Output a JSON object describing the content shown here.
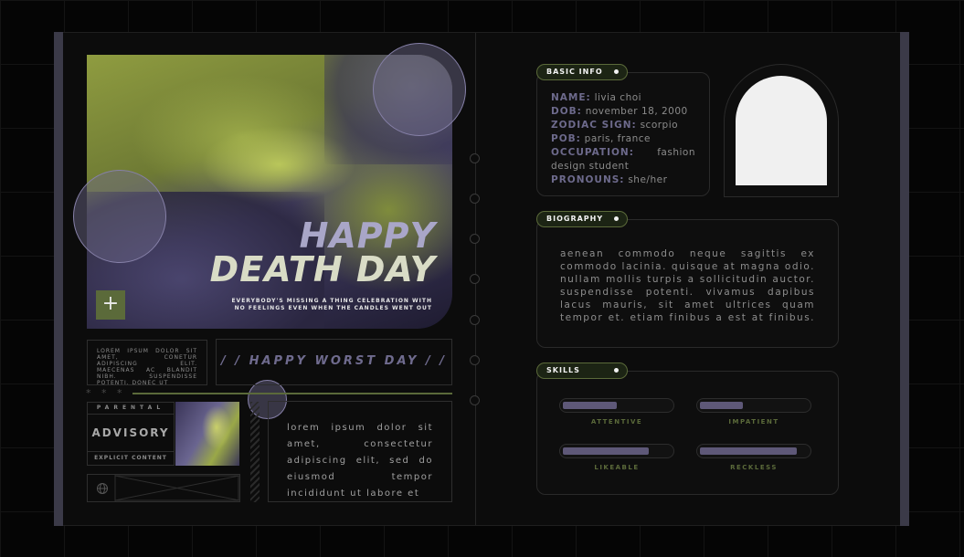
{
  "colors": {
    "accent_green": "#5b6a3a",
    "accent_purple": "#5e5878",
    "background": "#0c0c0c"
  },
  "hero": {
    "title_line1": "HAPPY",
    "title_line2": "DEATH DAY",
    "tagline": "EVERYBODY'S MISSING A THING CELEBRATION WITH NO FEELINGS EVEN WHEN THE CANDLES WENT OUT",
    "plus_icon": "plus-icon"
  },
  "left_blocks": {
    "small_lorem": "LOREM IPSUM DOLOR SIT AMET, CONETUR ADIPISCING ELIT. MAECENAS AC BLANDIT NIBH. SUSPENDISSE POTENTI. DONEC UT",
    "worst_day": "/ / HAPPY WORST DAY / /",
    "stars": "* * *",
    "parental": "PARENTAL",
    "advisory": "ADVISORY",
    "explicit": "EXPLICIT CONTENT",
    "lorem_medium": "lorem ipsum dolor sit amet, consectetur adipiscing elit, sed do eiusmod tempor incididunt ut labore et"
  },
  "basic_info": {
    "heading": "BASIC INFO",
    "rows": [
      {
        "label": "NAME:",
        "value": "livia choi"
      },
      {
        "label": "DOB:",
        "value": "november 18, 2000"
      },
      {
        "label": "ZODIAC SIGN:",
        "value": "scorpio"
      },
      {
        "label": "POB:",
        "value": "paris, france"
      },
      {
        "label": "OCCUPATION:",
        "value": "fashion"
      },
      {
        "label": "",
        "value": "design student"
      },
      {
        "label": "PRONOUNS:",
        "value": "she/her"
      }
    ]
  },
  "biography": {
    "heading": "BIOGRAPHY",
    "text": "aenean commodo neque sagittis ex commodo lacinia. quisque at magna odio. nullam mollis turpis a sollicitudin auctor. suspendisse potenti. vivamus dapibus lacus mauris, sit amet ultrices quam tempor et. etiam finibus a est at finibus. mauris eros magna, aliquet"
  },
  "skills": {
    "heading": "SKILLS",
    "items": [
      {
        "label": "ATTENTIVE",
        "level": 0.5
      },
      {
        "label": "IMPATIENT",
        "level": 0.4
      },
      {
        "label": "LIKEABLE",
        "level": 0.8
      },
      {
        "label": "RECKLESS",
        "level": 0.9
      }
    ]
  }
}
